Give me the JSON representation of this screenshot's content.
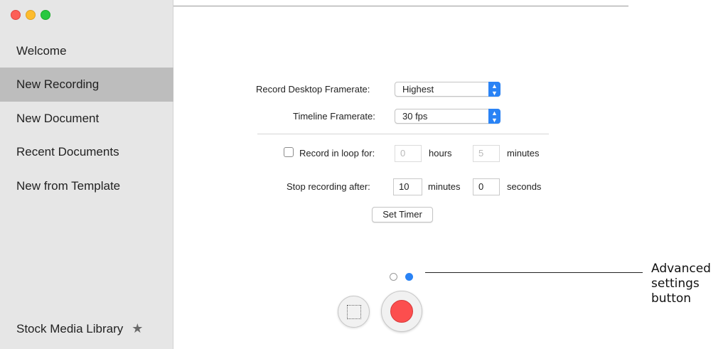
{
  "sidebar": {
    "items": [
      {
        "label": "Welcome"
      },
      {
        "label": "New Recording",
        "selected": true
      },
      {
        "label": "New Document"
      },
      {
        "label": "Recent Documents"
      },
      {
        "label": "New from Template"
      }
    ],
    "footer": {
      "label": "Stock Media Library",
      "icon": "star-icon"
    }
  },
  "recording": {
    "desktop_framerate": {
      "label": "Record Desktop Framerate:",
      "value": "Highest"
    },
    "timeline_framerate": {
      "label": "Timeline Framerate:",
      "value": "30 fps"
    },
    "loop": {
      "label": "Record in loop for:",
      "checked": false,
      "hours_placeholder": "0",
      "hours_unit": "hours",
      "minutes_placeholder": "5",
      "minutes_unit": "minutes"
    },
    "stop_after": {
      "label": "Stop recording after:",
      "minutes_value": "10",
      "minutes_unit": "minutes",
      "seconds_value": "0",
      "seconds_unit": "seconds"
    },
    "set_timer_label": "Set Timer"
  },
  "pager": {
    "pages": 2,
    "current": 2
  },
  "callout": {
    "line1": "Advanced",
    "line2": "settings",
    "line3": "button"
  },
  "colors": {
    "accent": "#2a83f5",
    "record": "#fc4e4e",
    "sidebar_bg": "#e6e6e6",
    "sidebar_selected": "#bdbdbd"
  }
}
